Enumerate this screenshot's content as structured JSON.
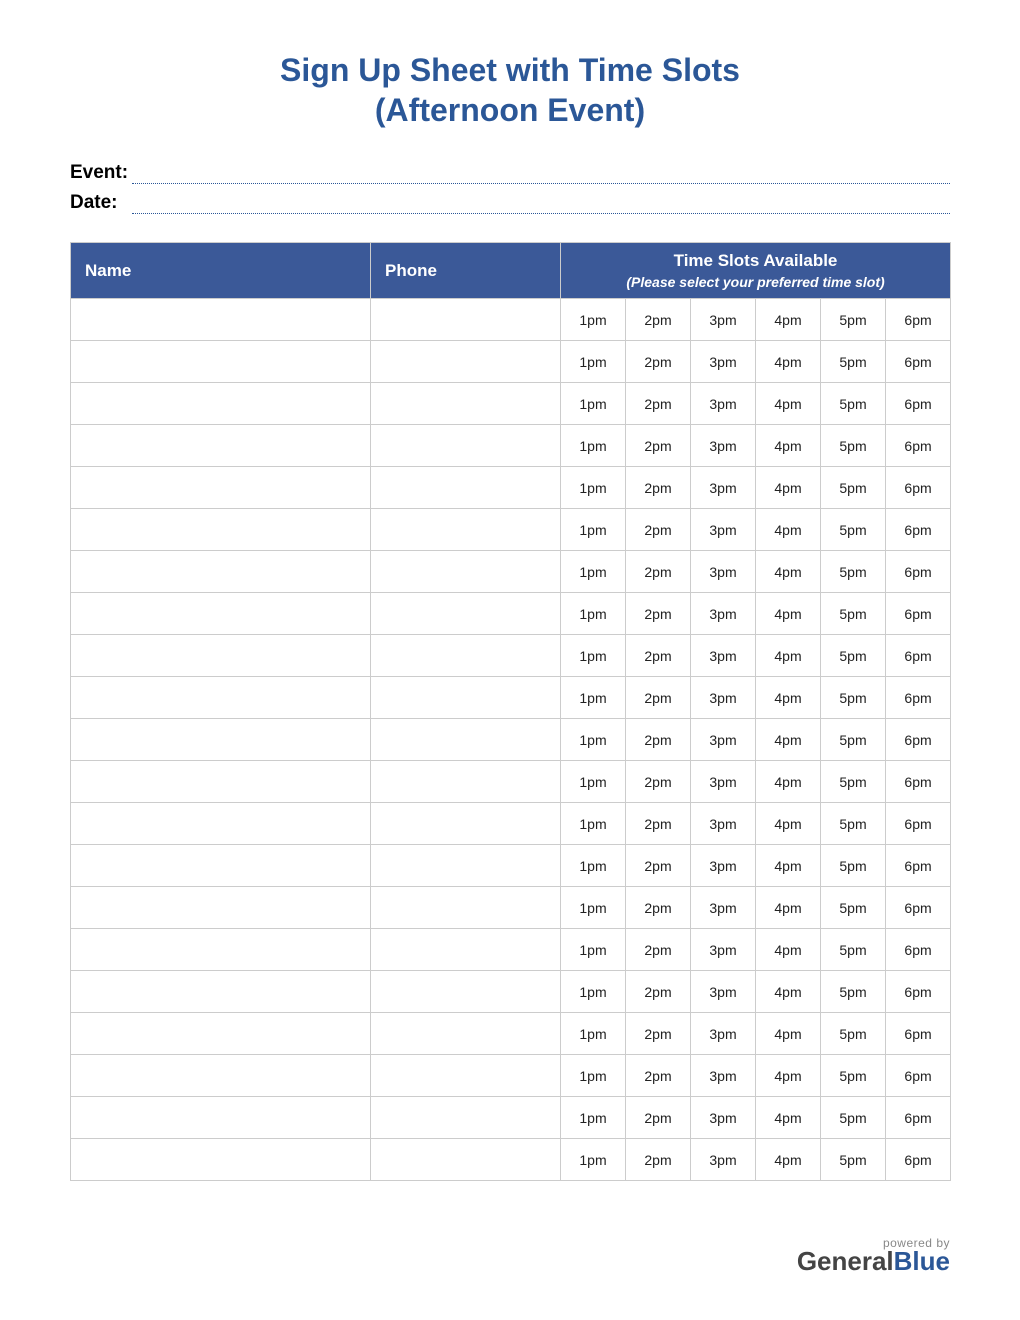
{
  "title_line1": "Sign Up Sheet with Time Slots",
  "title_line2": "(Afternoon Event)",
  "fields": {
    "event_label": "Event:",
    "date_label": "Date:"
  },
  "headers": {
    "name": "Name",
    "phone": "Phone",
    "slots_title": "Time Slots Available",
    "slots_sub": "(Please select your preferred time slot)"
  },
  "time_slots": [
    "1pm",
    "2pm",
    "3pm",
    "4pm",
    "5pm",
    "6pm"
  ],
  "row_count": 21,
  "footer": {
    "powered": "powered by",
    "brand_g": "General",
    "brand_b": "Blue"
  }
}
